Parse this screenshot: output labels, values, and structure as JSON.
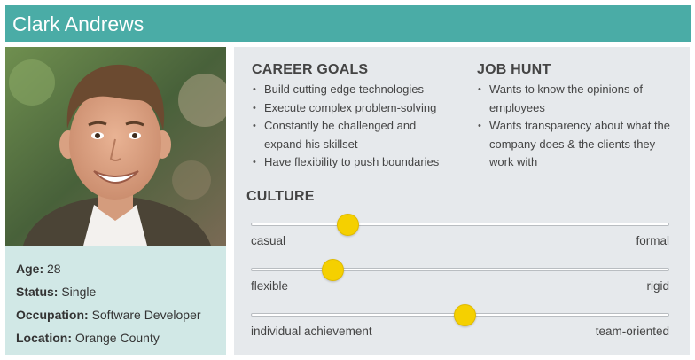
{
  "persona": {
    "name": "Clark Andrews"
  },
  "info": {
    "age_label": "Age:",
    "age_value": "28",
    "status_label": "Status:",
    "status_value": "Single",
    "occupation_label": "Occupation:",
    "occupation_value": "Software Developer",
    "location_label": "Location:",
    "location_value": "Orange County"
  },
  "career_goals": {
    "title": "CAREER GOALS",
    "items": [
      "Build cutting edge technologies",
      "Execute complex problem-solving",
      "Constantly be challenged and expand his skillset",
      "Have flexibility to push boundaries"
    ]
  },
  "job_hunt": {
    "title": "JOB HUNT",
    "items": [
      "Wants to know the opinions of employees",
      "Wants transparency about what the company does & the clients they work with"
    ]
  },
  "culture": {
    "title": "CULTURE",
    "sliders": [
      {
        "left": "casual",
        "right": "formal",
        "value": 0.23
      },
      {
        "left": "flexible",
        "right": "rigid",
        "value": 0.195
      },
      {
        "left": "individual achievement",
        "right": "team-oriented",
        "value": 0.51
      }
    ]
  },
  "colors": {
    "header": "#4aaca6",
    "info_bg": "#d1e8e6",
    "panel_bg": "#e6e9ec",
    "knob": "#f5d000"
  }
}
